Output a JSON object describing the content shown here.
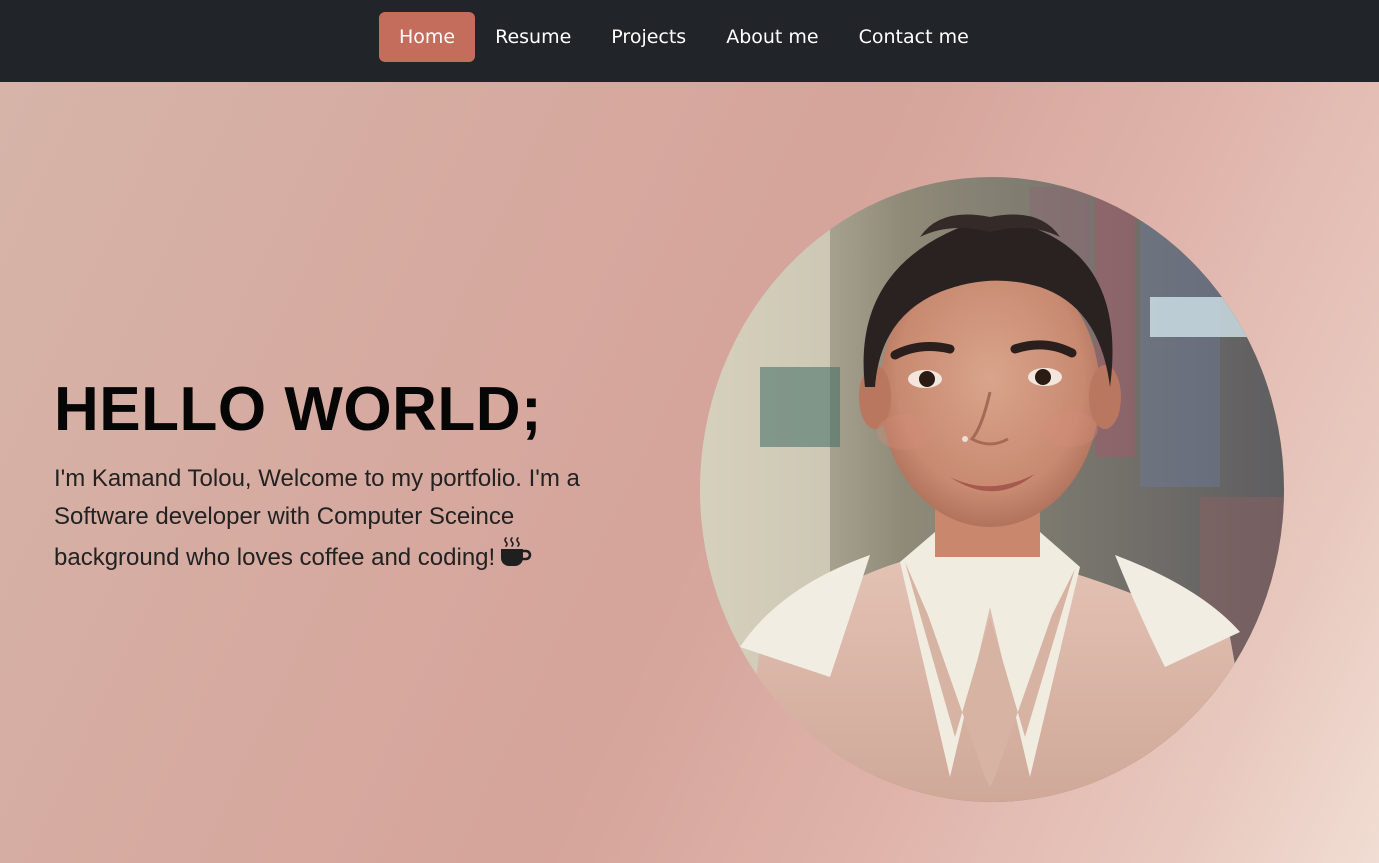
{
  "nav": {
    "items": [
      {
        "label": "Home",
        "active": true
      },
      {
        "label": "Resume",
        "active": false
      },
      {
        "label": "Projects",
        "active": false
      },
      {
        "label": "About me",
        "active": false
      },
      {
        "label": "Contact me",
        "active": false
      }
    ]
  },
  "hero": {
    "title": "HELLO WORLD;",
    "intro": "I'm Kamand Tolou, Welcome to my portfolio. I'm a Software developer with Computer Sceince background who loves coffee and coding!",
    "icon": "coffee-icon"
  },
  "colors": {
    "navbar_bg": "#212429",
    "active_nav": "#c56d5c",
    "nav_text": "#ffffff",
    "title_text": "#060606"
  }
}
